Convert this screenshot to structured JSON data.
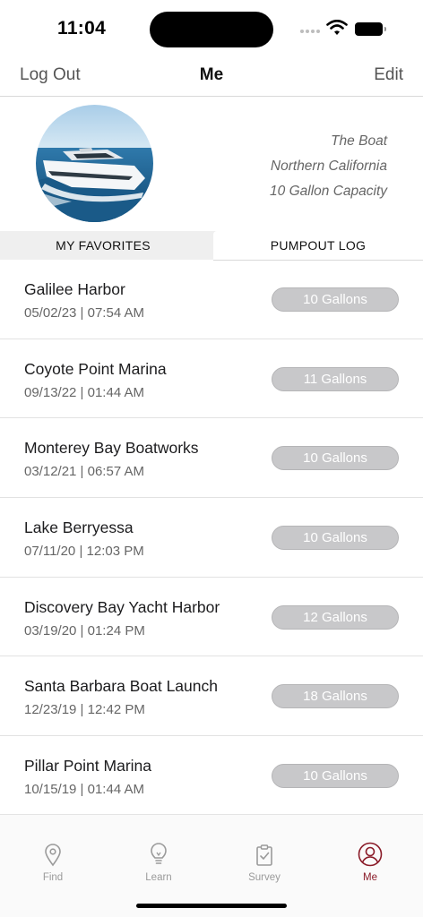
{
  "status_bar": {
    "time": "11:04"
  },
  "nav": {
    "left_label": "Log Out",
    "title": "Me",
    "right_label": "Edit"
  },
  "profile": {
    "boat_name": "The Boat",
    "region": "Northern California",
    "capacity": "10 Gallon Capacity"
  },
  "tabs": [
    {
      "label": "MY FAVORITES",
      "selected": false
    },
    {
      "label": "PUMPOUT LOG",
      "selected": true
    }
  ],
  "log": [
    {
      "location": "Galilee Harbor",
      "datetime": "05/02/23 | 07:54 AM",
      "amount": "10 Gallons"
    },
    {
      "location": "Coyote Point Marina",
      "datetime": "09/13/22 | 01:44 AM",
      "amount": "11 Gallons"
    },
    {
      "location": "Monterey Bay Boatworks",
      "datetime": "03/12/21 | 06:57 AM",
      "amount": "10 Gallons"
    },
    {
      "location": "Lake Berryessa",
      "datetime": "07/11/20 | 12:03 PM",
      "amount": "10 Gallons"
    },
    {
      "location": "Discovery Bay Yacht Harbor",
      "datetime": "03/19/20 | 01:24 PM",
      "amount": "12 Gallons"
    },
    {
      "location": "Santa Barbara Boat Launch",
      "datetime": "12/23/19 | 12:42 PM",
      "amount": "18 Gallons"
    },
    {
      "location": "Pillar Point Marina",
      "datetime": "10/15/19 | 01:44 AM",
      "amount": "10 Gallons"
    }
  ],
  "tab_bar": [
    {
      "label": "Find",
      "icon": "map-pin-icon",
      "active": false
    },
    {
      "label": "Learn",
      "icon": "lightbulb-icon",
      "active": false
    },
    {
      "label": "Survey",
      "icon": "clipboard-check-icon",
      "active": false
    },
    {
      "label": "Me",
      "icon": "person-circle-icon",
      "active": true
    }
  ],
  "colors": {
    "accent": "#8a1b28",
    "pill_bg": "#c8c8ca",
    "tab_bg": "#efefef"
  }
}
